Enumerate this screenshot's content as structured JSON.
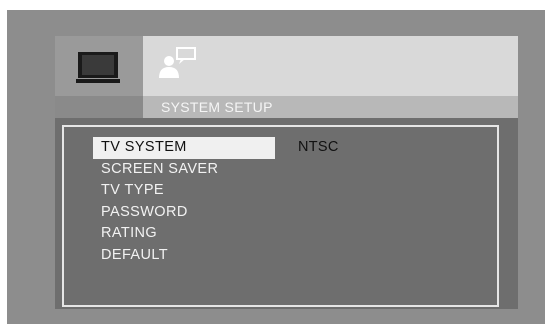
{
  "tabs": [
    {
      "name": "tv",
      "icon": "tv-icon",
      "active": true
    },
    {
      "name": "user",
      "icon": "user-speech-icon",
      "active": false
    }
  ],
  "title": "SYSTEM SETUP",
  "menu": {
    "items": [
      "TV SYSTEM",
      "SCREEN SAVER",
      "TV TYPE",
      "PASSWORD",
      "RATING",
      "DEFAULT"
    ],
    "selected_index": 0
  },
  "selected_value": "NTSC",
  "colors": {
    "outer_bg": "#8d8d8d",
    "panel_bg": "#6e6e6e",
    "tab_strip": "#d9d9d9",
    "highlight": "#f0f0f0",
    "text": "#f2f2f2"
  }
}
